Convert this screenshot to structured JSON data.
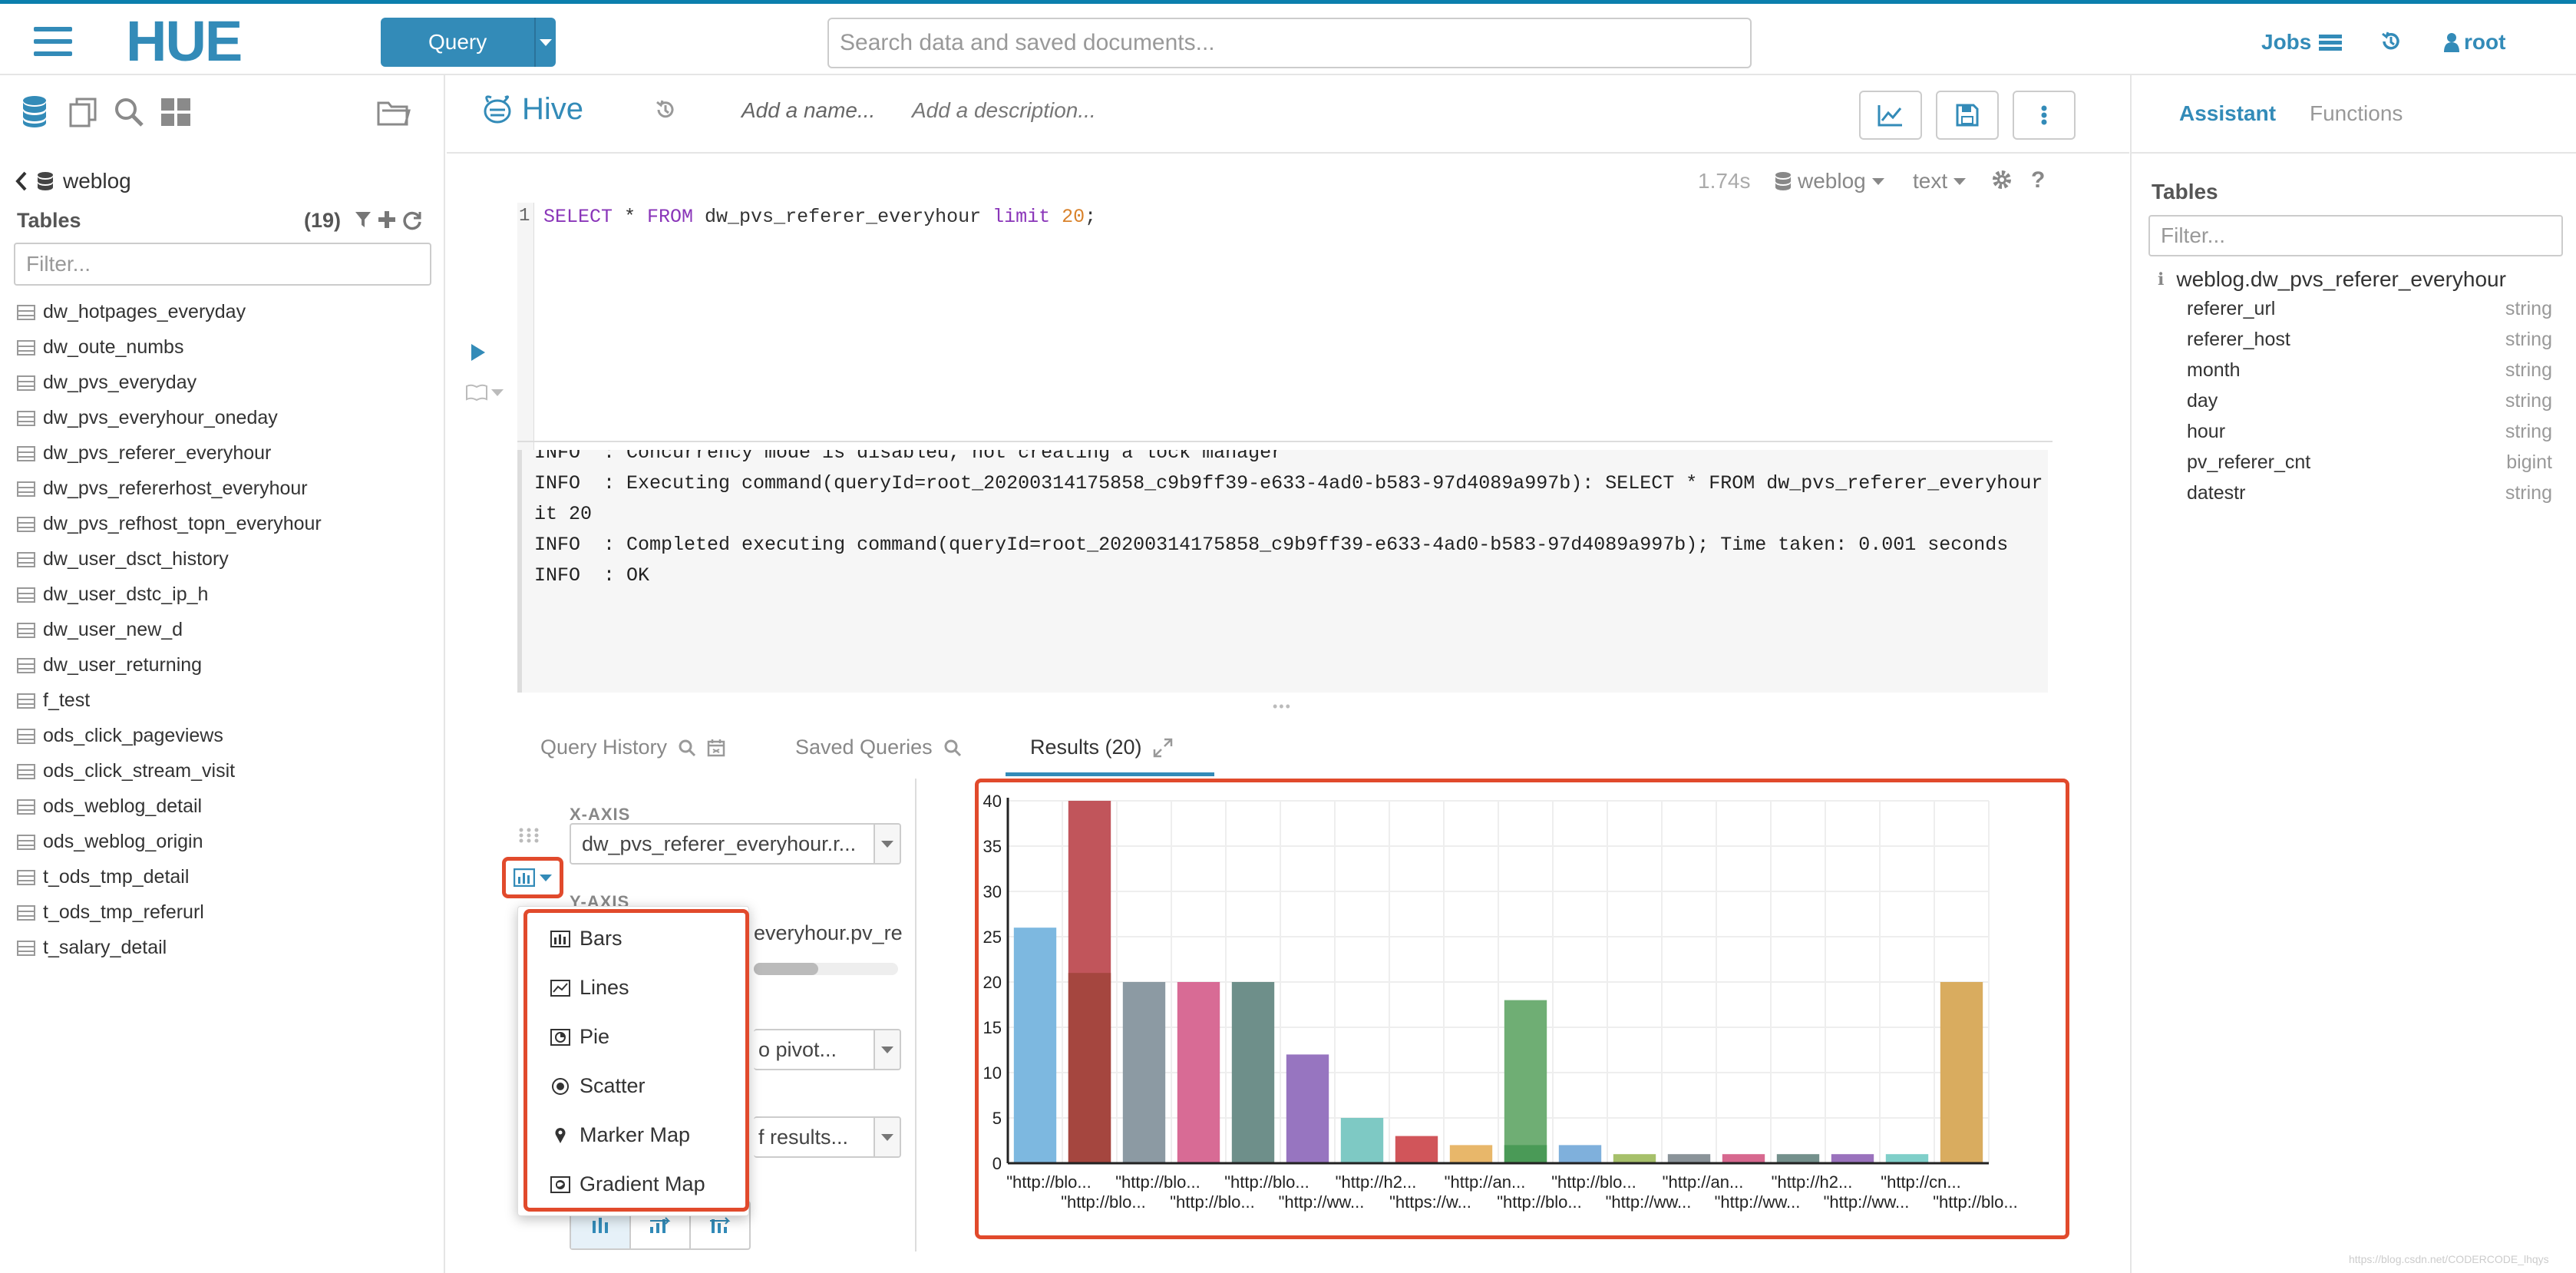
{
  "topbar": {
    "logo": "HUE",
    "query_button": "Query",
    "search_placeholder": "Search data and saved documents...",
    "jobs": "Jobs",
    "user": "root"
  },
  "left_panel": {
    "database": "weblog",
    "tables_title": "Tables",
    "tables_count": "(19)",
    "filter_placeholder": "Filter...",
    "tables": [
      "dw_hotpages_everyday",
      "dw_oute_numbs",
      "dw_pvs_everyday",
      "dw_pvs_everyhour_oneday",
      "dw_pvs_referer_everyhour",
      "dw_pvs_refererhost_everyhour",
      "dw_pvs_refhost_topn_everyhour",
      "dw_user_dsct_history",
      "dw_user_dstc_ip_h",
      "dw_user_new_d",
      "dw_user_returning",
      "f_test",
      "ods_click_pageviews",
      "ods_click_stream_visit",
      "ods_weblog_detail",
      "ods_weblog_origin",
      "t_ods_tmp_detail",
      "t_ods_tmp_referurl",
      "t_salary_detail"
    ]
  },
  "editor": {
    "engine": "Hive",
    "name_placeholder": "Add a name...",
    "description_placeholder": "Add a description...",
    "exec_time": "1.74s",
    "database": "weblog",
    "format": "text",
    "line_number": "1",
    "query_parts": {
      "kw1": "SELECT",
      "star": " * ",
      "kw2": "FROM",
      "table": " dw_pvs_referer_everyhour ",
      "kw3": "limit",
      "num": " 20",
      "semi": ";"
    },
    "log_lines": [
      "INFO  : Concurrency mode is disabled, not creating a lock manager",
      "INFO  : Executing command(queryId=root_20200314175858_c9b9ff39-e633-4ad0-b583-97d4089a997b): SELECT * FROM dw_pvs_referer_everyhour lim",
      "it 20",
      "INFO  : Completed executing command(queryId=root_20200314175858_c9b9ff39-e633-4ad0-b583-97d4089a997b); Time taken: 0.001 seconds",
      "INFO  : OK"
    ]
  },
  "results": {
    "tabs": {
      "history": "Query History",
      "saved": "Saved Queries",
      "results": "Results (20)"
    },
    "x_axis_label": "X-AXIS",
    "x_axis_value": "dw_pvs_referer_everyhour.r...",
    "y_axis_label": "Y-AXIS",
    "y_axis_value": "everyhour.pv_re",
    "pivot_value": "o pivot...",
    "limit_value": "f results...",
    "chart_menu": [
      "Bars",
      "Lines",
      "Pie",
      "Scatter",
      "Marker Map",
      "Gradient Map"
    ]
  },
  "assistant": {
    "tab_assistant": "Assistant",
    "tab_functions": "Functions",
    "tables_title": "Tables",
    "filter_placeholder": "Filter...",
    "table_name": "weblog.dw_pvs_referer_everyhour",
    "columns": [
      {
        "name": "referer_url",
        "type": "string"
      },
      {
        "name": "referer_host",
        "type": "string"
      },
      {
        "name": "month",
        "type": "string"
      },
      {
        "name": "day",
        "type": "string"
      },
      {
        "name": "hour",
        "type": "string"
      },
      {
        "name": "pv_referer_cnt",
        "type": "bigint"
      },
      {
        "name": "datestr",
        "type": "string"
      }
    ]
  },
  "watermark": "https://blog.csdn.net/CODERCODE_lhqys",
  "colors": {
    "accent": "#338bb8",
    "highlight_box": "#e14a2c"
  },
  "chart_data": {
    "type": "bar",
    "ylim": [
      0,
      40
    ],
    "yticks": [
      0,
      5,
      10,
      15,
      20,
      25,
      30,
      35,
      40
    ],
    "series": [
      {
        "values": [
          26,
          40,
          20,
          20,
          20,
          12,
          5,
          3,
          2,
          18,
          2,
          1,
          1,
          1,
          1,
          1,
          1,
          20
        ]
      },
      {
        "values": [
          0,
          21,
          0,
          0,
          0,
          0,
          0,
          0,
          0,
          2,
          0,
          0,
          0,
          0,
          0,
          0,
          0,
          0
        ]
      }
    ],
    "bar_colors": [
      "#7db8e0",
      "#c1555b",
      "#8c9aa3",
      "#d86b95",
      "#6e8f8a",
      "#9775c0",
      "#7ec9c4",
      "#d1555a",
      "#e8b76a",
      "#6fae74",
      "#7fb0dc",
      "#a6c06a",
      "#8a9399",
      "#d7688f",
      "#74908c",
      "#9a72bd",
      "#7fcfc9",
      "#d9ac5f"
    ],
    "overlay_colors": [
      "",
      "#a5463f",
      "",
      "",
      "",
      "",
      "",
      "",
      "",
      "#4a9a57",
      "",
      "",
      "",
      "",
      "",
      "",
      "",
      ""
    ],
    "x_labels_row1": [
      "\"http://blo...",
      "\"http://blo...",
      "\"http://blo...",
      "\"http://h2...",
      "\"http://an...",
      "\"http://blo...",
      "\"http://an...",
      "\"http://h2...",
      "\"http://cn..."
    ],
    "x_labels_row2": [
      "\"http://blo...",
      "\"http://blo...",
      "\"http://ww...",
      "\"https://w...",
      "\"http://blo...",
      "\"http://ww...",
      "\"http://ww...",
      "\"http://ww...",
      "\"http://blo..."
    ]
  }
}
